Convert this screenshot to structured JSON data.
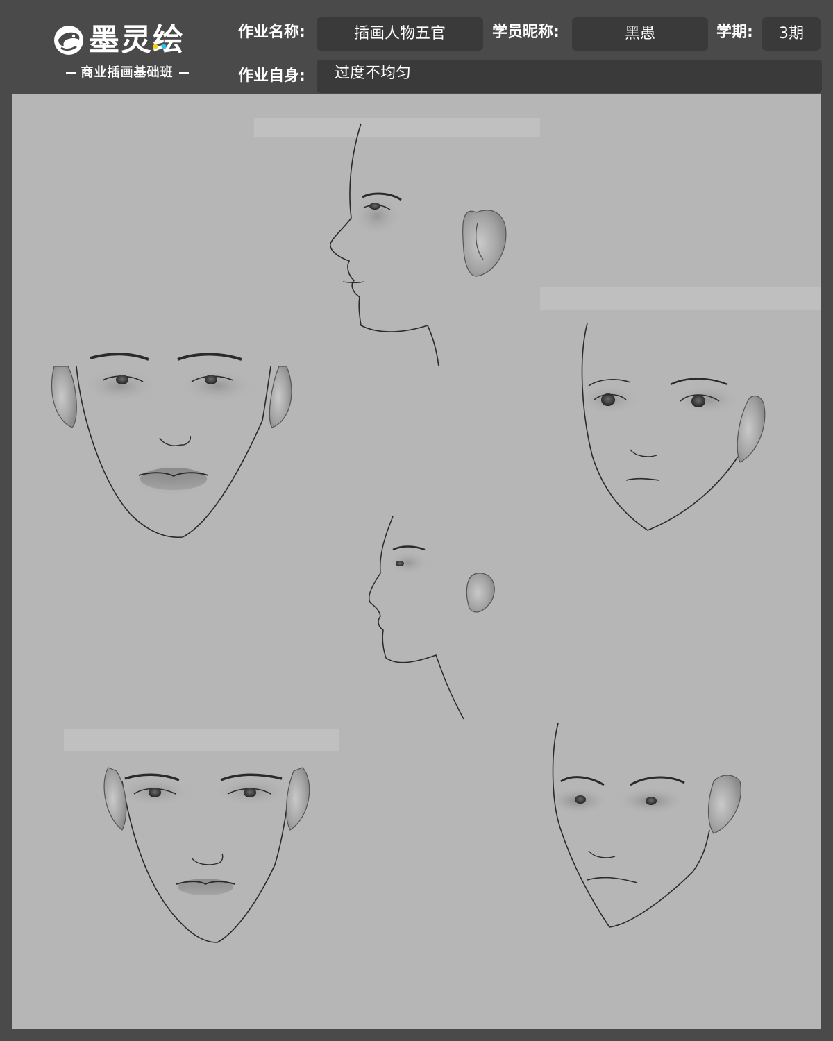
{
  "logo": {
    "title": "墨灵绘",
    "subtitle": "商业插画基础班"
  },
  "form": {
    "assignment_name_label": "作业名称:",
    "assignment_name_value": "插画人物五官",
    "student_nickname_label": "学员昵称:",
    "student_nickname_value": "黑愚",
    "term_label": "学期:",
    "term_value": "3期",
    "self_review_label": "作业自身:",
    "self_review_value": "过度不均匀"
  },
  "colors": {
    "page_background": "#4a4a4a",
    "field_background": "#3a3a3a",
    "canvas_background": "#b6b6b6",
    "line_art": "#2a2a2a",
    "logo_accent_yellow": "#f2d21b",
    "logo_accent_cyan": "#2ec4e6"
  },
  "artwork": {
    "subject": "six grayscale face studies: two profile views, two front views, two three-quarter views"
  }
}
